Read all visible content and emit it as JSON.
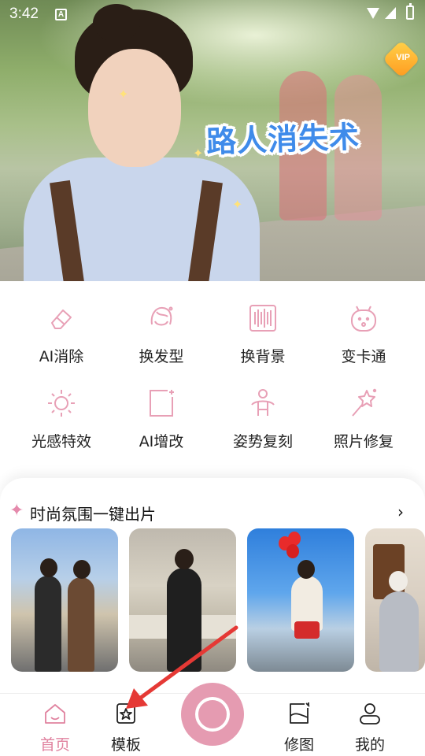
{
  "status_bar": {
    "time": "3:42",
    "app_indicator": "A"
  },
  "banner": {
    "title": "路人消失术",
    "vip_badge": "VIP"
  },
  "tools": [
    {
      "label": "AI消除",
      "icon": "eraser-icon"
    },
    {
      "label": "换发型",
      "icon": "hairstyle-icon"
    },
    {
      "label": "换背景",
      "icon": "background-icon"
    },
    {
      "label": "变卡通",
      "icon": "cartoon-icon"
    },
    {
      "label": "光感特效",
      "icon": "sun-icon"
    },
    {
      "label": "AI增改",
      "icon": "ai-edit-icon"
    },
    {
      "label": "姿势复刻",
      "icon": "pose-icon"
    },
    {
      "label": "照片修复",
      "icon": "magic-wand-icon"
    }
  ],
  "templates": {
    "title": "时尚氛围一键出片",
    "more_icon": "chevron-right-icon"
  },
  "nav": {
    "home": "首页",
    "templates": "模板",
    "edit": "修图",
    "profile": "我的"
  },
  "colors": {
    "accent": "#e59bb1",
    "active_text": "#e0829f",
    "icon_stroke": "#e8a0b6",
    "annotation_arrow": "#e53935"
  }
}
